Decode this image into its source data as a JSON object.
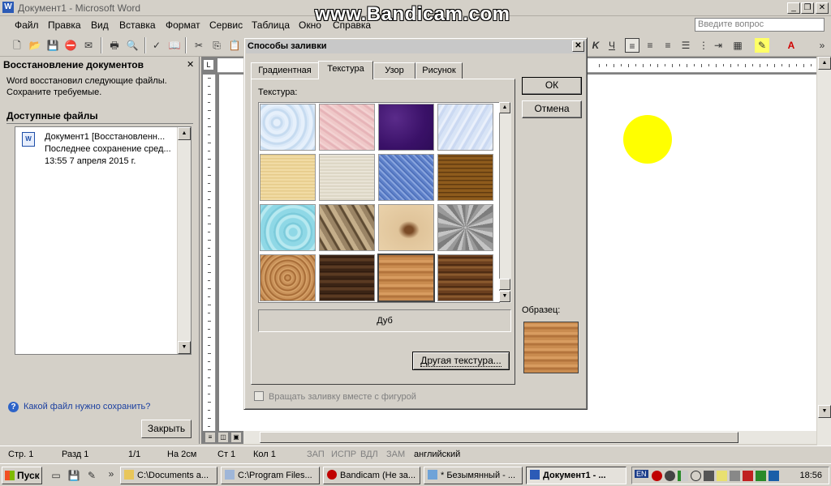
{
  "window": {
    "title": "Документ1 - Microsoft Word",
    "watermark": "www.Bandicam.com"
  },
  "menu": [
    "Файл",
    "Правка",
    "Вид",
    "Вставка",
    "Формат",
    "Сервис",
    "Таблица",
    "Окно",
    "Справка"
  ],
  "help_placeholder": "Введите вопрос",
  "taskpane": {
    "title": "Восстановление документов",
    "message_line1": "Word восстановил следующие файлы.",
    "message_line2": "Сохраните требуемые.",
    "available_header": "Доступные файлы",
    "file": {
      "name": "Документ1  [Восстановленн...",
      "saved": "Последнее сохранение сред...",
      "time": "13:55 7 апреля 2015 г."
    },
    "help_link": "Какой файл нужно сохранить?",
    "close_button": "Закрыть"
  },
  "dialog": {
    "title": "Способы заливки",
    "tabs": [
      "Градиентная",
      "Текстура",
      "Узор",
      "Рисунок"
    ],
    "active_tab": "Текстура",
    "texture_label": "Текстура:",
    "selected_texture": "Дуб",
    "other_texture_button": "Другая текстура...",
    "ok_button": "ОК",
    "cancel_button": "Отмена",
    "sample_label": "Образец:",
    "rotate_checkbox": "Вращать заливку вместе с фигурой",
    "rotate_checked": false
  },
  "status": {
    "page": "Стр. 1",
    "section": "Разд 1",
    "page_of": "1/1",
    "at": "На 2см",
    "line": "Ст 1",
    "column": "Кол 1",
    "rec": "ЗАП",
    "trk": "ИСПР",
    "ext": "ВДЛ",
    "ovr": "ЗАМ",
    "language": "английский"
  },
  "taskbar": {
    "start": "Пуск",
    "items": [
      "C:\\Documents a...",
      "C:\\Program Files...",
      "Bandicam (Не за...",
      "* Безымянный - ...",
      "Документ1 - ..."
    ],
    "active_item": "Документ1 - ...",
    "lang": "EN",
    "clock": "18:56"
  },
  "colors": {
    "sun": "#ffff00",
    "oak": "#c98b4f"
  }
}
